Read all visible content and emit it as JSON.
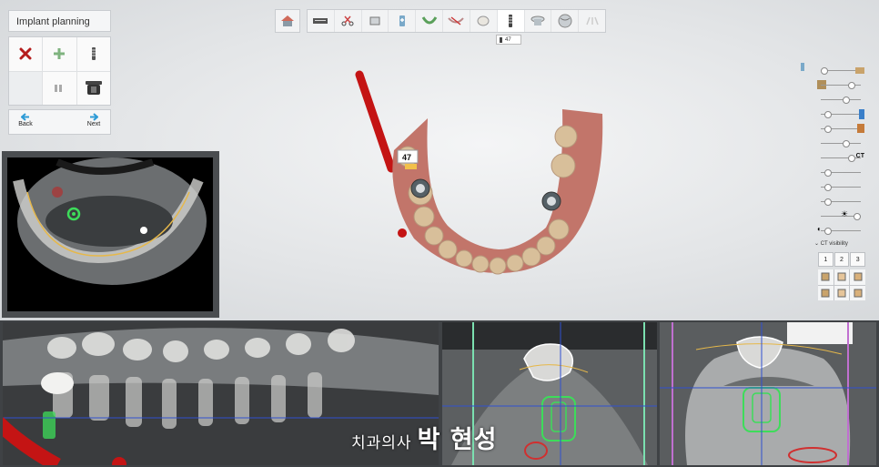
{
  "panel": {
    "title": "Implant planning"
  },
  "nav": {
    "back_label": "Back",
    "next_label": "Next"
  },
  "toolbar": {
    "steps": [
      "scan-icon",
      "scissors-icon",
      "model-icon",
      "implant-add-icon",
      "arch-icon",
      "segment-icon",
      "crown-icon",
      "implant-icon",
      "abutment-icon",
      "sphere-icon",
      "guide-icon"
    ]
  },
  "tooth_tag": {
    "label": "47"
  },
  "scene": {
    "tooth_label": "47"
  },
  "right_panel": {
    "ct_label": "CT",
    "ct_visibility_label": "CT visibility",
    "layout_buttons": [
      "1",
      "2",
      "3"
    ]
  },
  "watermark": {
    "small": "치과의사",
    "big": "박 현성"
  },
  "colors": {
    "accent": "#2e9bd6",
    "implant_green": "#3ddc5a",
    "drill_red": "#c41414",
    "gum_pink": "#c2756a"
  }
}
